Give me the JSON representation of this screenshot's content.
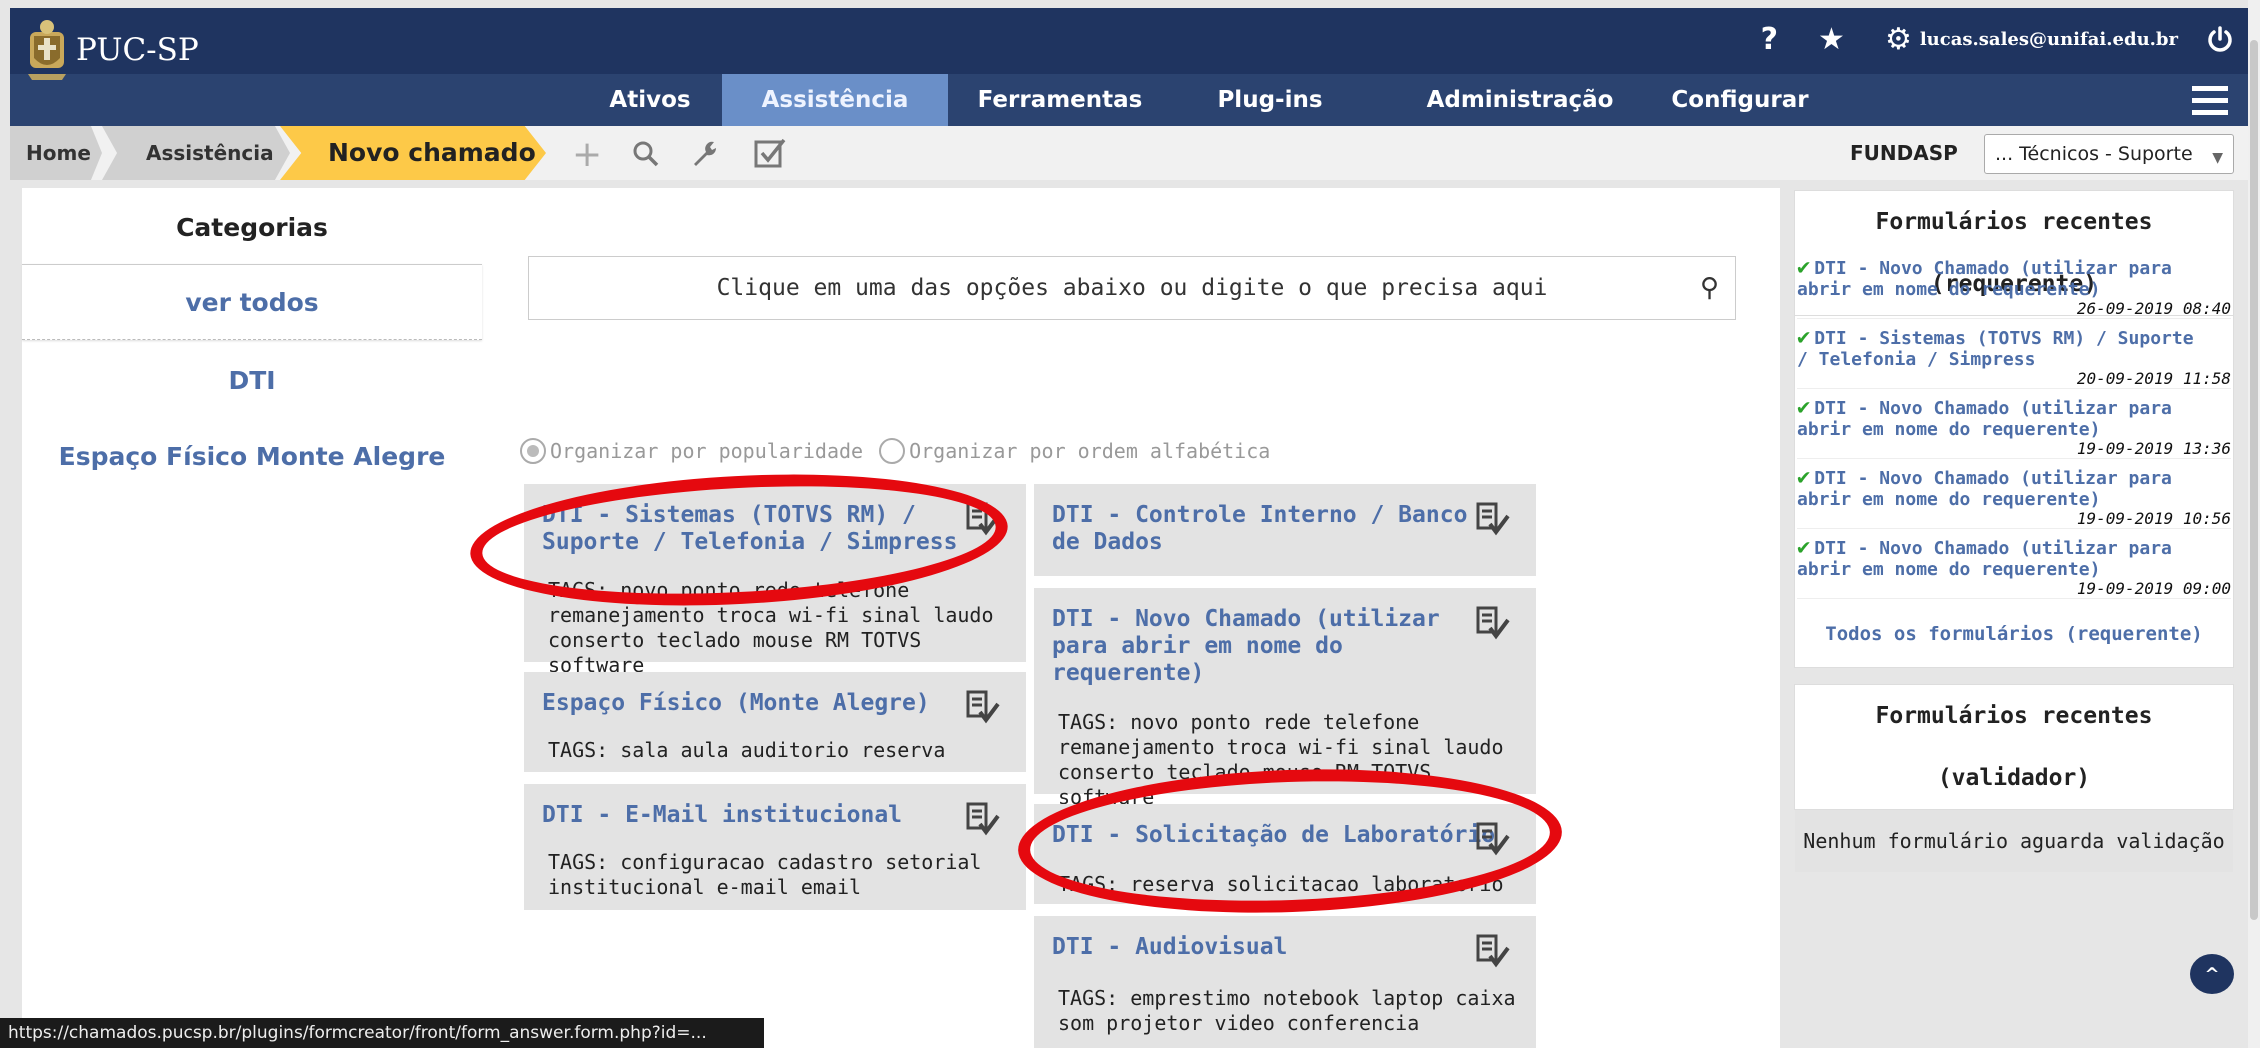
{
  "app": {
    "logo_text": "PUC-SP",
    "user_email": "lucas.sales@unifai.edu.br",
    "help": "?"
  },
  "menu": [
    "Ativos",
    "Assistência",
    "Ferramentas",
    "Plug-ins",
    "Administração",
    "Configurar"
  ],
  "menu_active": "Assistência",
  "breadcrumb": {
    "home": "Home",
    "assistencia": "Assistência",
    "current": "Novo chamado"
  },
  "toolbar_icons": [
    "plus-icon",
    "search-icon",
    "wrench-icon",
    "checkbox-icon"
  ],
  "entity": {
    "label": "FUNDASP",
    "profile": "... Técnicos - Suporte"
  },
  "categories": {
    "title": "Categorias",
    "selected": "ver todos",
    "items": [
      "DTI",
      "Espaço Físico Monte Alegre"
    ]
  },
  "search": {
    "placeholder": "Clique em uma das opções abaixo ou digite o que precisa aqui"
  },
  "sort": {
    "popularity": "Organizar por popularidade",
    "alpha": "Organizar por ordem alfabética"
  },
  "forms": [
    {
      "title_1": "DTI - Sistemas (TOTVS RM) /",
      "title_2": "Suporte / Telefonia / Simpress",
      "tags_1": "TAGS: novo ponto rede telefone",
      "tags_2": "remanejamento troca wi-fi sinal laudo",
      "tags_3": "conserto teclado mouse RM TOTVS software"
    },
    {
      "title_1": "Espaço Físico (Monte Alegre)",
      "tags_1": "TAGS: sala aula auditorio reserva"
    },
    {
      "title_1": "DTI - E-Mail institucional",
      "tags_1": "TAGS: configuracao cadastro setorial",
      "tags_2": "institucional e-mail email"
    },
    {
      "title_1": "DTI - Controle Interno / Banco",
      "title_2": "de Dados"
    },
    {
      "title_1": "DTI - Novo Chamado (utilizar",
      "title_2": "para abrir em nome do",
      "title_3": "requerente)",
      "tags_1": "TAGS: novo ponto rede telefone",
      "tags_2": "remanejamento troca wi-fi sinal laudo",
      "tags_3": "conserto teclado mouse RM TOTVS software"
    },
    {
      "title_1": "DTI - Solicitação de Laboratório",
      "tags_1": "TAGS: reserva solicitacao laboratorio"
    },
    {
      "title_1": "DTI - Audiovisual",
      "tags_1": "TAGS: emprestimo notebook laptop caixa",
      "tags_2": "som projetor video conferencia"
    }
  ],
  "recent_requester": {
    "title": "Formulários recentes (requerente)",
    "items": [
      {
        "l1": "DTI - Novo Chamado (utilizar para",
        "l2": "abrir em nome do requerente)",
        "date": "26-09-2019 08:40"
      },
      {
        "l1": "DTI - Sistemas (TOTVS RM) / Suporte",
        "l2": "/ Telefonia / Simpress",
        "date": "20-09-2019 11:58"
      },
      {
        "l1": "DTI - Novo Chamado (utilizar para",
        "l2": "abrir em nome do requerente)",
        "date": "19-09-2019 13:36"
      },
      {
        "l1": "DTI - Novo Chamado (utilizar para",
        "l2": "abrir em nome do requerente)",
        "date": "19-09-2019 10:56"
      },
      {
        "l1": "DTI - Novo Chamado (utilizar para",
        "l2": "abrir em nome do requerente)",
        "date": "19-09-2019 09:00"
      }
    ],
    "all_link": "Todos os formulários (requerente)"
  },
  "recent_validator": {
    "title": "Formulários recentes (validador)",
    "empty": "Nenhum formulário aguarda validação"
  },
  "status_url": "https://chamados.pucsp.br/plugins/formcreator/front/form_answer.form.php?id=...",
  "colors": {
    "header": "#1f3460",
    "menu": "#2b4370",
    "menu_active": "#6a8fc8",
    "breadcrumb_current": "#fdc948",
    "link": "#4d6ea8",
    "annotation": "#e5090f"
  }
}
